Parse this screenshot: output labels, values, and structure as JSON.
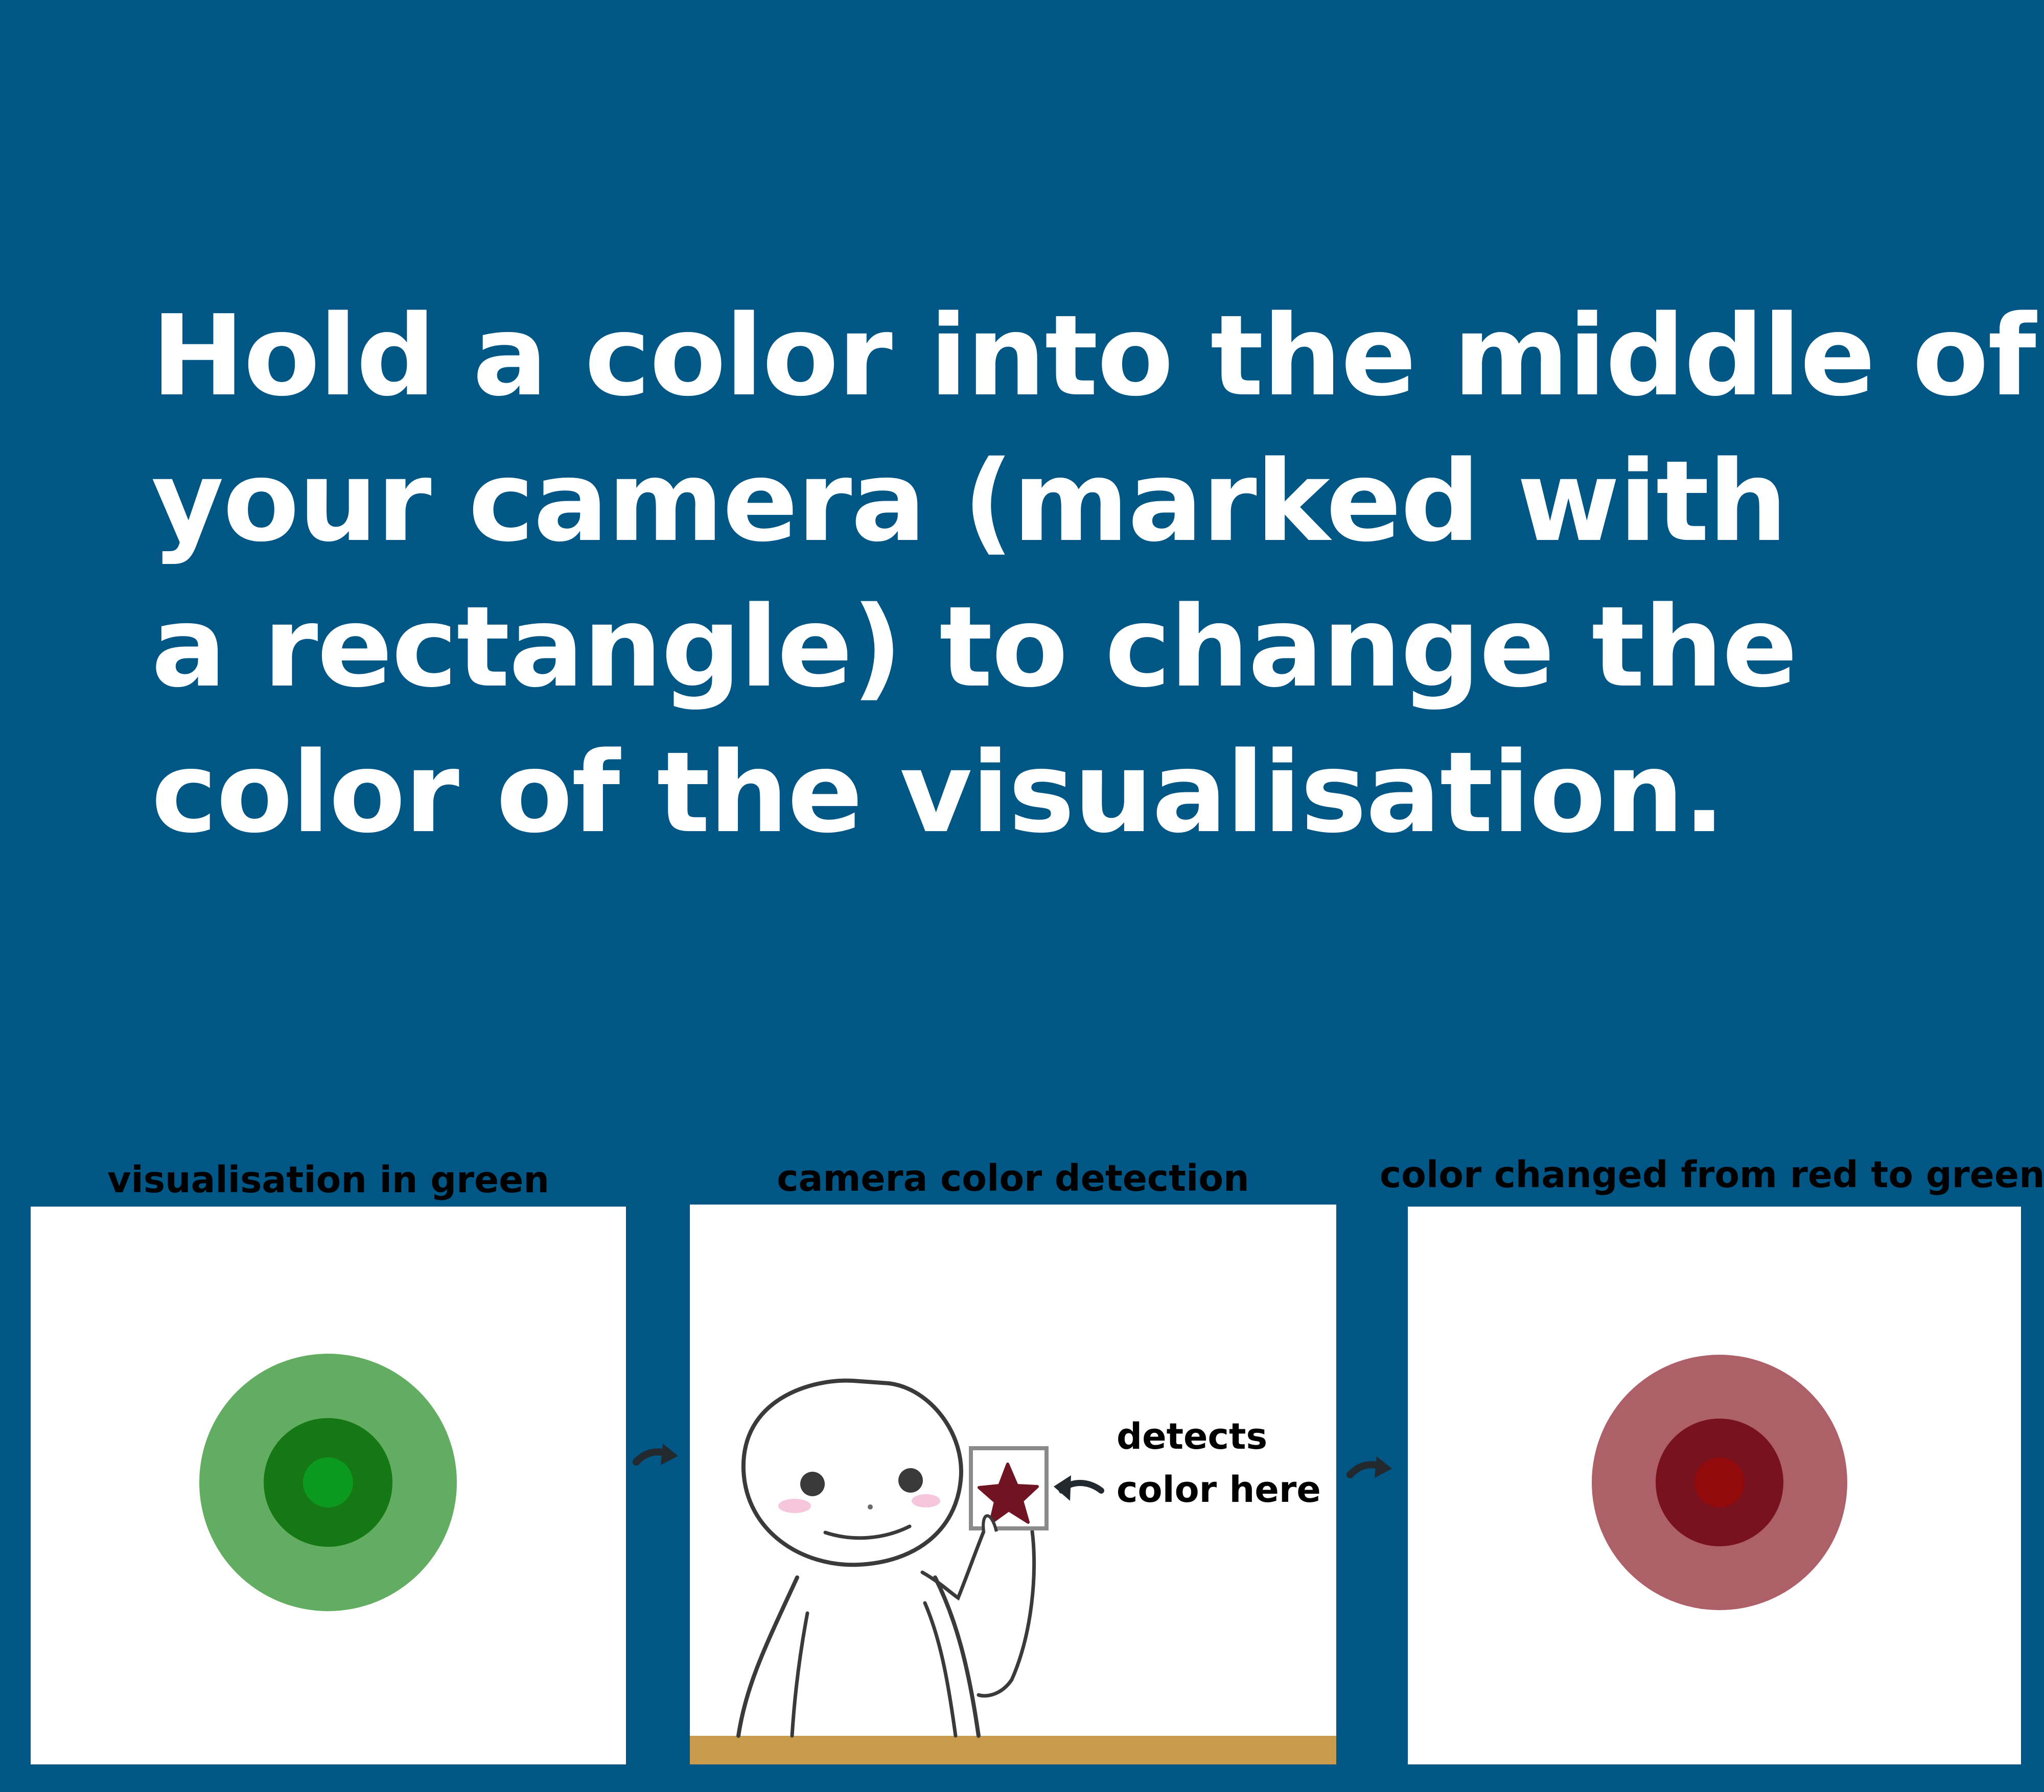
{
  "headline": {
    "lines": [
      "Hold a color into the middle of",
      "your camera (marked with",
      "a rectangle) to change the",
      "color of the visualisation."
    ]
  },
  "panels": [
    {
      "title": "visualisation in green",
      "rings": {
        "outer": "#63ad63",
        "middle": "#157814",
        "center": "#0b9a1f"
      }
    },
    {
      "title": "camera color detection",
      "detect_label": [
        "detects",
        "color here"
      ],
      "star_color": "#701423",
      "floor_color": "#c89c4c"
    },
    {
      "title": "color changed from red to green",
      "rings": {
        "outer": "#ad6068",
        "middle": "#78121f",
        "center": "#920a0b"
      }
    }
  ],
  "colors": {
    "background": "#005685",
    "text": "#ffffff"
  }
}
